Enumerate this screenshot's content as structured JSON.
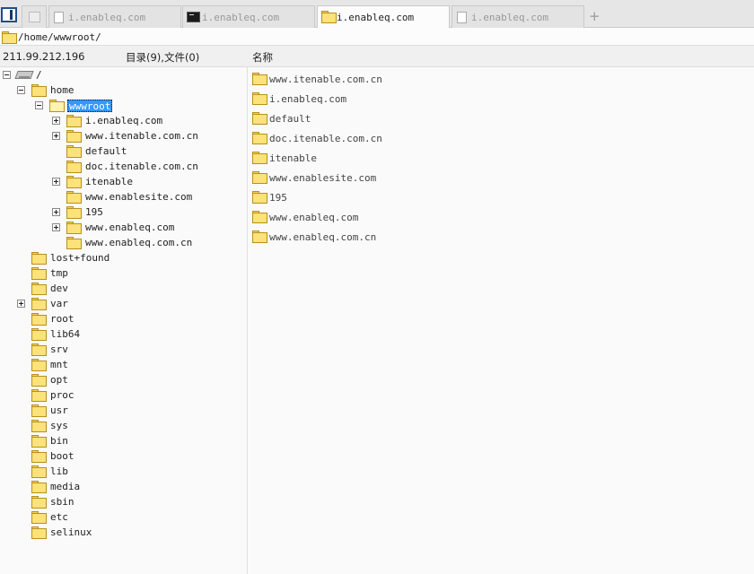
{
  "tabs": [
    {
      "label": "i.enableq.com",
      "icon": "page-icon",
      "active": false
    },
    {
      "label": "i.enableq.com",
      "icon": "terminal-icon",
      "active": false
    },
    {
      "label": "i.enableq.com",
      "icon": "folder-icon",
      "active": true
    },
    {
      "label": "i.enableq.com",
      "icon": "page-icon",
      "active": false
    }
  ],
  "new_tab": "+",
  "address": {
    "path": "/home/wwwroot/"
  },
  "header": {
    "server_ip": "211.99.212.196",
    "dir_count": "目录(9),文件(0)",
    "column_name": "名称"
  },
  "tree": [
    {
      "label": "/",
      "depth": 0,
      "expander": "minus",
      "icon": "drive-icon"
    },
    {
      "label": "home",
      "depth": 1,
      "expander": "minus",
      "icon": "folder-icon"
    },
    {
      "label": "wwwroot",
      "depth": 2,
      "expander": "minus",
      "icon": "folder-open-icon",
      "selected": true
    },
    {
      "label": "i.enableq.com",
      "depth": 3,
      "expander": "plus",
      "icon": "folder-icon"
    },
    {
      "label": "www.itenable.com.cn",
      "depth": 3,
      "expander": "plus",
      "icon": "folder-icon"
    },
    {
      "label": "default",
      "depth": 3,
      "expander": "",
      "icon": "folder-icon"
    },
    {
      "label": "doc.itenable.com.cn",
      "depth": 3,
      "expander": "",
      "icon": "folder-icon"
    },
    {
      "label": "itenable",
      "depth": 3,
      "expander": "plus",
      "icon": "folder-icon"
    },
    {
      "label": "www.enablesite.com",
      "depth": 3,
      "expander": "",
      "icon": "folder-icon"
    },
    {
      "label": "195",
      "depth": 3,
      "expander": "plus",
      "icon": "folder-icon"
    },
    {
      "label": "www.enableq.com",
      "depth": 3,
      "expander": "plus",
      "icon": "folder-icon"
    },
    {
      "label": "www.enableq.com.cn",
      "depth": 3,
      "expander": "",
      "icon": "folder-icon"
    },
    {
      "label": "lost+found",
      "depth": 1,
      "expander": "",
      "icon": "folder-icon"
    },
    {
      "label": "tmp",
      "depth": 1,
      "expander": "",
      "icon": "folder-icon"
    },
    {
      "label": "dev",
      "depth": 1,
      "expander": "",
      "icon": "folder-icon"
    },
    {
      "label": "var",
      "depth": 1,
      "expander": "plus",
      "icon": "folder-icon"
    },
    {
      "label": "root",
      "depth": 1,
      "expander": "",
      "icon": "folder-icon"
    },
    {
      "label": "lib64",
      "depth": 1,
      "expander": "",
      "icon": "folder-icon"
    },
    {
      "label": "srv",
      "depth": 1,
      "expander": "",
      "icon": "folder-icon"
    },
    {
      "label": "mnt",
      "depth": 1,
      "expander": "",
      "icon": "folder-icon"
    },
    {
      "label": "opt",
      "depth": 1,
      "expander": "",
      "icon": "folder-icon"
    },
    {
      "label": "proc",
      "depth": 1,
      "expander": "",
      "icon": "folder-icon"
    },
    {
      "label": "usr",
      "depth": 1,
      "expander": "",
      "icon": "folder-icon"
    },
    {
      "label": "sys",
      "depth": 1,
      "expander": "",
      "icon": "folder-icon"
    },
    {
      "label": "bin",
      "depth": 1,
      "expander": "",
      "icon": "folder-icon"
    },
    {
      "label": "boot",
      "depth": 1,
      "expander": "",
      "icon": "folder-icon"
    },
    {
      "label": "lib",
      "depth": 1,
      "expander": "",
      "icon": "folder-icon"
    },
    {
      "label": "media",
      "depth": 1,
      "expander": "",
      "icon": "folder-icon"
    },
    {
      "label": "sbin",
      "depth": 1,
      "expander": "",
      "icon": "folder-icon"
    },
    {
      "label": "etc",
      "depth": 1,
      "expander": "",
      "icon": "folder-icon"
    },
    {
      "label": "selinux",
      "depth": 1,
      "expander": "",
      "icon": "folder-icon"
    }
  ],
  "files": [
    {
      "name": "www.itenable.com.cn",
      "icon": "folder-icon"
    },
    {
      "name": "i.enableq.com",
      "icon": "folder-icon"
    },
    {
      "name": "default",
      "icon": "folder-icon"
    },
    {
      "name": "doc.itenable.com.cn",
      "icon": "folder-icon"
    },
    {
      "name": "itenable",
      "icon": "folder-icon"
    },
    {
      "name": "www.enablesite.com",
      "icon": "folder-icon"
    },
    {
      "name": "195",
      "icon": "folder-icon"
    },
    {
      "name": "www.enableq.com",
      "icon": "folder-icon"
    },
    {
      "name": "www.enableq.com.cn",
      "icon": "folder-icon"
    }
  ],
  "colors": {
    "selection": "#3399ff",
    "folder": "#fbe27a",
    "folder_border": "#b8901e"
  }
}
